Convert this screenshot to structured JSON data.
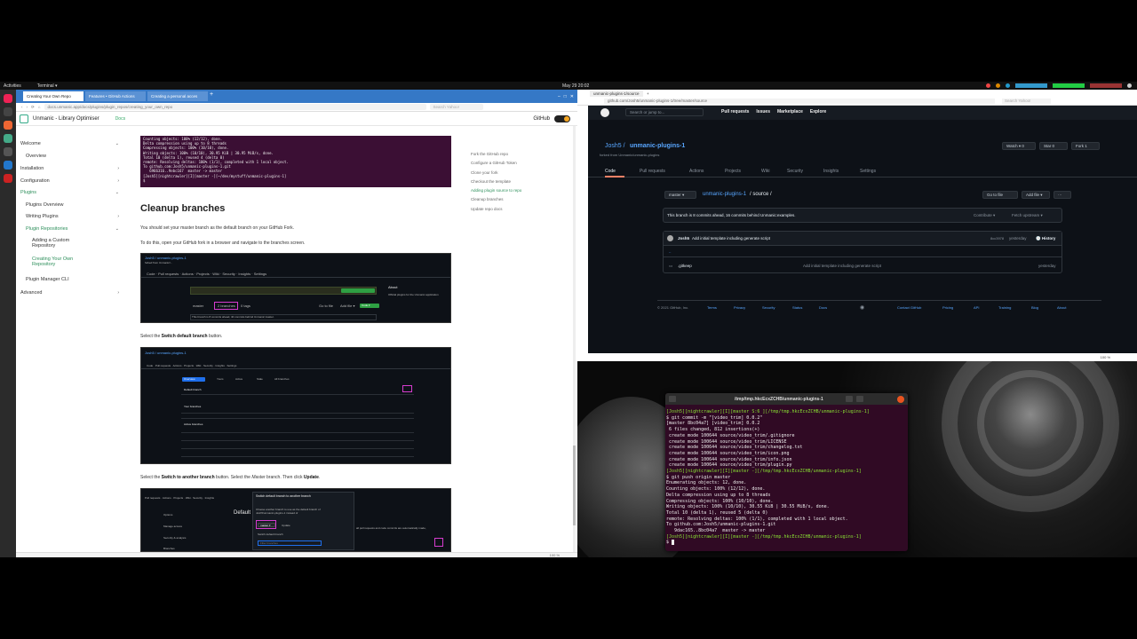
{
  "topbar": {
    "activities": "Activities",
    "app": "Terminal ▾",
    "clock": "May 29  20:02"
  },
  "left_browser": {
    "tabs": [
      "Creating Your Own Repo",
      "Features • GitHub Actions",
      "Creating a personal acces"
    ],
    "url": "docs.unmanic.app/docs/plugins/plugin_repos/creating_your_own_repo",
    "search_placeholder": "Search Yahoo!",
    "app_title": "Unmanic - Library Optimiser",
    "docs_link": "Docs",
    "github_label": "GitHub",
    "sidebar": {
      "welcome": "Welcome",
      "overview": "Overview",
      "installation": "Installation",
      "configuration": "Configuration",
      "plugins": "Plugins",
      "plugins_overview": "Plugins Overview",
      "writing_plugins": "Writing Plugins",
      "plugin_repositories": "Plugin Repositories",
      "adding_custom_repo_1": "Adding a Custom",
      "adding_custom_repo_2": "Repository",
      "creating_own_repo_1": "Creating Your Own",
      "creating_own_repo_2": "Repository",
      "plugin_manager_cli": "Plugin Manager CLI",
      "advanced": "Advanced"
    },
    "terminal_snippet": "Counting objects: 100% (12/12), done.\nDelta compression using up to 8 threads\nCompressing objects: 100% (10/10), done.\nWriting objects: 100% (10/10), 30.95 KiB | 30.95 MiB/s, done.\nTotal 10 (delta 1), reused 4 (delta 0)\nremote: Resolving deltas: 100% (1/1), completed with 1 local object.\nTo github.com:Josh5/unmanic-plugins-1.git\n   6966316..9ebc167  master -> master\n[Josh5][nightcrawler][I][master -][~/dev/mystuff/unmanic-plugins-1]\n$ ",
    "heading": "Cleanup branches",
    "para1": "You should set your master branch as the default branch on your GitHub Fork.",
    "para2": "To do this, open your GitHub fork in a browser and navigate to the branches screen.",
    "para3_pre": "Select the ",
    "para3_bold": "Switch default branch",
    "para3_post": " button.",
    "para4_pre": "Select the ",
    "para4_bold": "Switch to another branch",
    "para4_mid": " button. Select the ",
    "para4_italic": "Master",
    "para4_mid2": " branch. Then click ",
    "para4_bold2": "Update",
    "para4_post": ".",
    "shot1": {
      "repo": "Josh5 / unmanic-plugins-1",
      "fork": "forked from Unmanic/...",
      "about": "About",
      "desc": "Official plugins for the Unmanic application",
      "branch": "master",
      "branches": "2 branches",
      "tags": "0 tags",
      "note": "This branch is 8 commits ahead, 40 commits behind Unmanic:master.",
      "go_to_file": "Go to file",
      "add_file": "Add file ▾",
      "code": "Code ▾"
    },
    "shot2": {
      "repo": "Josh5 / unmanic-plugins-1",
      "tabs": [
        "Overview",
        "Yours",
        "Active",
        "Stale",
        "All branches"
      ],
      "sections": [
        "Default branch",
        "Your branches",
        "Active branches"
      ]
    },
    "shot3": {
      "title": "Switch default branch to another branch",
      "body": "Choose another branch to use as the default branch of Josh5/unmanic-plugins-1 instead of",
      "branch": "master ▾",
      "update": "Update",
      "menu": [
        "Options",
        "Manage access",
        "Security & analysis",
        "Branches"
      ],
      "heading": "Default",
      "filter": "Filter branches",
      "switch_label": "Switch default branch"
    },
    "toc": [
      "Fork the GitHub repo",
      "Configure a GitHub Token",
      "Clone your fork",
      "Checkout the template",
      "Adding plugin source to repo",
      "Cleanup branches",
      "Update repo docs"
    ],
    "zoom": "100 %"
  },
  "right_browser": {
    "tab": "unmanic-plugins-1/source",
    "url": "github.com/Josh5/unmanic-plugins-1/tree/master/source",
    "search_placeholder": "Search Yahoo!",
    "header": {
      "search": "Search or jump to...",
      "nav": [
        "Pull requests",
        "Issues",
        "Marketplace",
        "Explore"
      ]
    },
    "repo_owner": "Josh5 / ",
    "repo_name": "unmanic-plugins-1",
    "forked_from": "forked from Unmanic/unmanic-plugins",
    "watch": "Watch ▾",
    "watch_count": "0",
    "star": "Star",
    "star_count": "0",
    "fork": "Fork",
    "fork_count": "1",
    "tabs": [
      "Code",
      "Pull requests",
      "Actions",
      "Projects",
      "Wiki",
      "Security",
      "Insights",
      "Settings"
    ],
    "branch": "master ▾",
    "path_repo": "unmanic-plugins-1",
    "path_rest": " / source /",
    "go_to_file": "Go to file",
    "add_file": "Add file ▾",
    "more": "···",
    "ahead_note": "This branch is 8 commits ahead, 16 commits behind Unmanic:examples.",
    "contribute": "Contribute ▾",
    "fetch": "Fetch upstream ▾",
    "commit_author": "Josh5",
    "commit_msg": "Add initial template including generate script",
    "commit_hash": "8cc3978",
    "commit_when": "yesterday",
    "history": "History",
    "parent": "..",
    "file_name": ".gitkeep",
    "file_msg": "Add initial template including generate script",
    "file_when": "yesterday",
    "footer": [
      "© 2021 GitHub, Inc.",
      "Terms",
      "Privacy",
      "Security",
      "Status",
      "Docs",
      "Contact GitHub",
      "Pricing",
      "API",
      "Training",
      "Blog",
      "About"
    ]
  },
  "right_status": {
    "zoom": "100 %"
  },
  "terminal": {
    "title": "/tmp/tmp.hkcEcxZCHB/unmanic-plugins-1",
    "lines": [
      "[Josh5][nightcrawler][I][master S:6 ][/tmp/tmp.hkcEcxZCHB/unmanic-plugins-1]",
      "$ git commit -m \"[video_trim] 0.0.2\"",
      "[master 8bc04a7] [video_trim] 0.0.2",
      " 6 files changed, 812 insertions(+)",
      " create mode 100644 source/video_trim/.gitignore",
      " create mode 100644 source/video_trim/LICENSE",
      " create mode 100644 source/video_trim/changelog.txt",
      " create mode 100644 source/video_trim/icon.png",
      " create mode 100644 source/video_trim/info.json",
      " create mode 100644 source/video_trim/plugin.py",
      "[Josh5][nightcrawler][I][master -][/tmp/tmp.hkcEcxZCHB/unmanic-plugins-1]",
      "$ git push origin master",
      "Enumerating objects: 12, done.",
      "Counting objects: 100% (12/12), done.",
      "Delta compression using up to 8 threads",
      "Compressing objects: 100% (10/10), done.",
      "Writing objects: 100% (10/10), 30.55 KiB | 30.55 MiB/s, done.",
      "Total 10 (delta 1), reused 5 (delta 0)",
      "remote: Resolving deltas: 100% (1/1), completed with 1 local object.",
      "To github.com:Josh5/unmanic-plugins-1.git",
      "   9dac165..8bc04a7  master -> master",
      "[Josh5][nightcrawler][I][master -][/tmp/tmp.hkcEcxZCHB/unmanic-plugins-1]",
      "$ "
    ]
  }
}
